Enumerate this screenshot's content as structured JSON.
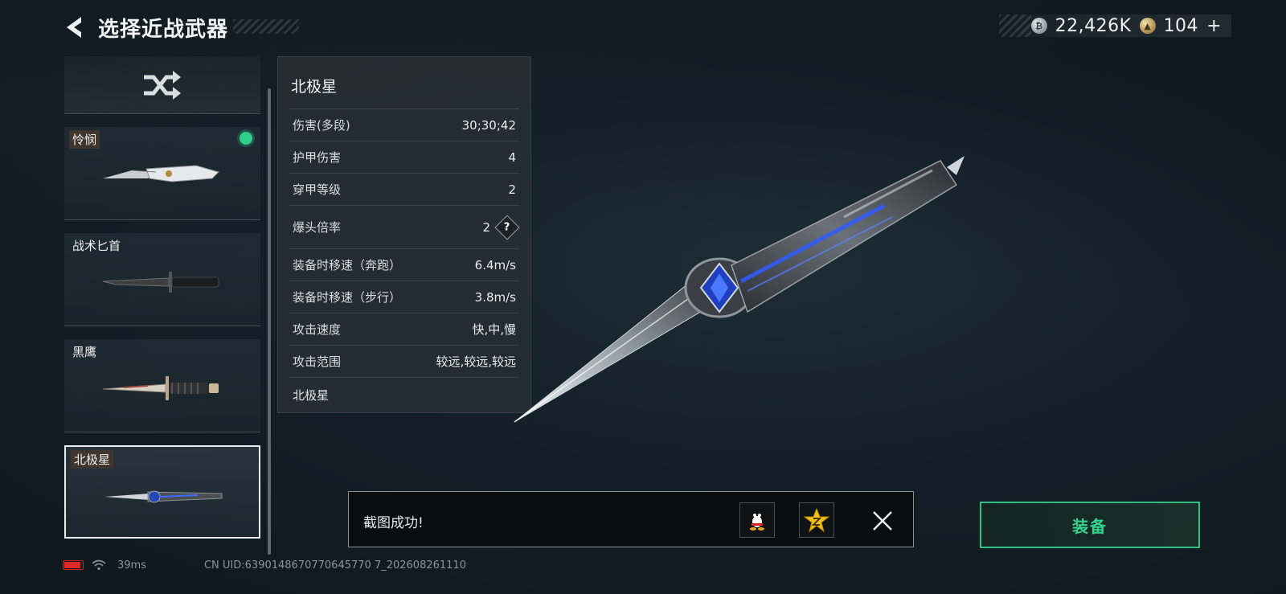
{
  "header": {
    "title": "选择近战武器"
  },
  "currency": {
    "silver_value": "22,426K",
    "gold_value": "104",
    "add_label": "+"
  },
  "weapon_list": {
    "items": [
      {
        "label": "怜悯",
        "equipped": true,
        "selected": false
      },
      {
        "label": "战术匕首",
        "equipped": false,
        "selected": false
      },
      {
        "label": "黑鹰",
        "equipped": false,
        "selected": false
      },
      {
        "label": "北极星",
        "equipped": false,
        "selected": true
      }
    ]
  },
  "stats": {
    "title": "北极星",
    "rows": [
      {
        "label": "伤害(多段)",
        "value": "30;30;42"
      },
      {
        "label": "护甲伤害",
        "value": "4"
      },
      {
        "label": "穿甲等级",
        "value": "2"
      },
      {
        "label": "爆头倍率",
        "value": "2",
        "help": "?"
      },
      {
        "label": "装备时移速（奔跑）",
        "value": "6.4m/s"
      },
      {
        "label": "装备时移速（步行）",
        "value": "3.8m/s"
      },
      {
        "label": "攻击速度",
        "value": "快,中,慢"
      },
      {
        "label": "攻击范围",
        "value": "较远,较远,较远"
      }
    ],
    "footer": "北极星"
  },
  "toast": {
    "message": "截图成功!"
  },
  "equip": {
    "label": "装备"
  },
  "status": {
    "ping": "39ms",
    "uid": "CN UID:6390148670770645770 7_202608261110"
  },
  "colors": {
    "accent_green": "#2fd18a",
    "equip_border": "#2fbf82",
    "battery_red": "#e02828"
  }
}
